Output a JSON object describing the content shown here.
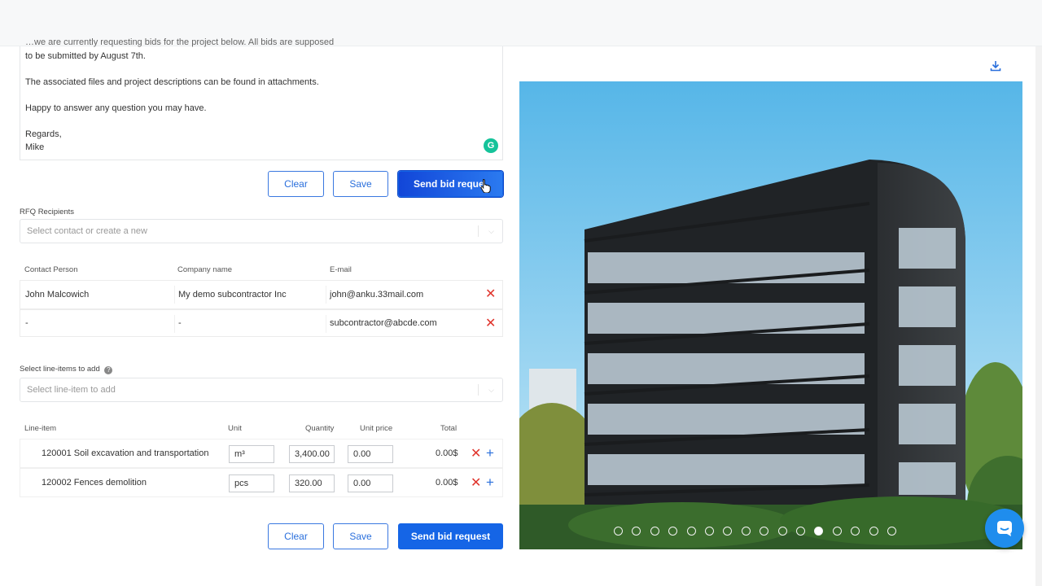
{
  "message": {
    "cut_line": "…we are currently requesting bids for the project below. All bids are supposed",
    "line1": "to be submitted by August 7th.",
    "line2": "The associated files and project descriptions can be found in attachments.",
    "line3": "Happy to answer any question you may have.",
    "line4": "Regards,",
    "line5": "Mike"
  },
  "buttons": {
    "clear": "Clear",
    "save": "Save",
    "send": "Send bid request",
    "send_truncated": "Send bid reque"
  },
  "recipients": {
    "label": "RFQ Recipients",
    "placeholder": "Select contact or create a new",
    "headers": [
      "Contact Person",
      "Company name",
      "E-mail"
    ],
    "rows": [
      {
        "contact": "John Malcowich",
        "company": "My demo subcontractor Inc",
        "email": "john@anku.33mail.com"
      },
      {
        "contact": "-",
        "company": "-",
        "email": "subcontractor@abcde.com"
      }
    ]
  },
  "line_items": {
    "label": "Select line-items to add",
    "placeholder": "Select line-item to add",
    "headers": [
      "Line-item",
      "Unit",
      "Quantity",
      "Unit price",
      "Total"
    ],
    "rows": [
      {
        "name": "120001 Soil excavation and transportation",
        "unit": "m³",
        "quantity": "3,400.00",
        "unit_price": "0.00",
        "total": "0.00$"
      },
      {
        "name": "120002 Fences demolition",
        "unit": "pcs",
        "quantity": "320.00",
        "unit_price": "0.00",
        "total": "0.00$"
      }
    ]
  },
  "gallery": {
    "dot_count": 16,
    "active_dot": 11
  },
  "colors": {
    "primary": "#1565e6",
    "danger": "#e0342c",
    "chat": "#1f8ded"
  }
}
